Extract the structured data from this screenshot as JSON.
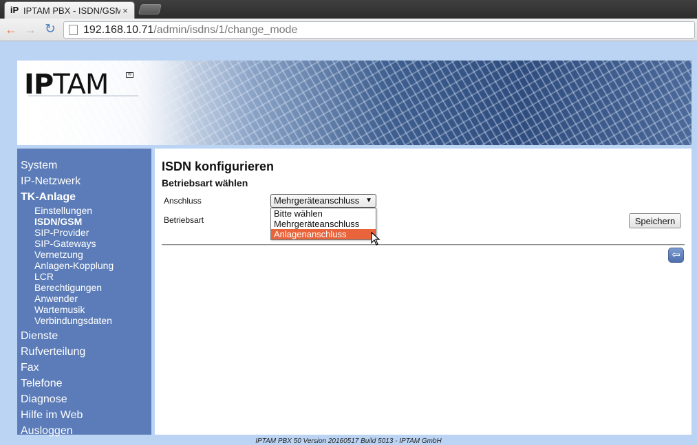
{
  "browser": {
    "tab_favicon": "iP",
    "tab_title": "IPTAM PBX - ISDN/GSM",
    "tab_close": "×",
    "nav_back_icon": "←",
    "nav_forward_icon": "→",
    "nav_reload_icon": "↻",
    "url_host": "192.168.10.71",
    "url_path": "/admin/isdns/1/change_mode"
  },
  "logo": {
    "strong": "IP",
    "light": "TAM",
    "mark": "®"
  },
  "sidebar": {
    "items_top": [
      {
        "label": "System"
      },
      {
        "label": "IP-Netzwerk"
      }
    ],
    "active_group": {
      "label": "TK-Anlage",
      "children": [
        {
          "label": "Einstellungen"
        },
        {
          "label": "ISDN/GSM"
        },
        {
          "label": "SIP-Provider"
        },
        {
          "label": "SIP-Gateways"
        },
        {
          "label": "Vernetzung"
        },
        {
          "label": "Anlagen-Kopplung"
        },
        {
          "label": "LCR"
        },
        {
          "label": "Berechtigungen"
        },
        {
          "label": "Anwender"
        },
        {
          "label": "Wartemusik"
        },
        {
          "label": "Verbindungsdaten"
        }
      ]
    },
    "items_bottom": [
      {
        "label": "Dienste"
      },
      {
        "label": "Rufverteilung"
      },
      {
        "label": "Fax"
      },
      {
        "label": "Telefone"
      },
      {
        "label": "Diagnose"
      },
      {
        "label": "Hilfe im Web"
      },
      {
        "label": "Ausloggen"
      }
    ]
  },
  "main": {
    "title": "ISDN konfigurieren",
    "section": "Betriebsart wählen",
    "anschluss_label": "Anschluss",
    "betriebsart_label": "Betriebsart",
    "select_value": "Mehrgeräteanschluss",
    "select_arrow": "▼",
    "options": [
      {
        "label": "Bitte wählen"
      },
      {
        "label": "Mehrgeräteanschluss"
      },
      {
        "label": "Anlagenanschluss"
      }
    ],
    "save_button": "Speichern",
    "back_icon": "⇦"
  },
  "footer": "IPTAM PBX 50 Version 20160517 Build 5013 - IPTAM GmbH",
  "colors": {
    "sidebar_bg": "#5b7cb8",
    "page_bg": "#bcd4f3",
    "highlight": "#e9643a"
  }
}
